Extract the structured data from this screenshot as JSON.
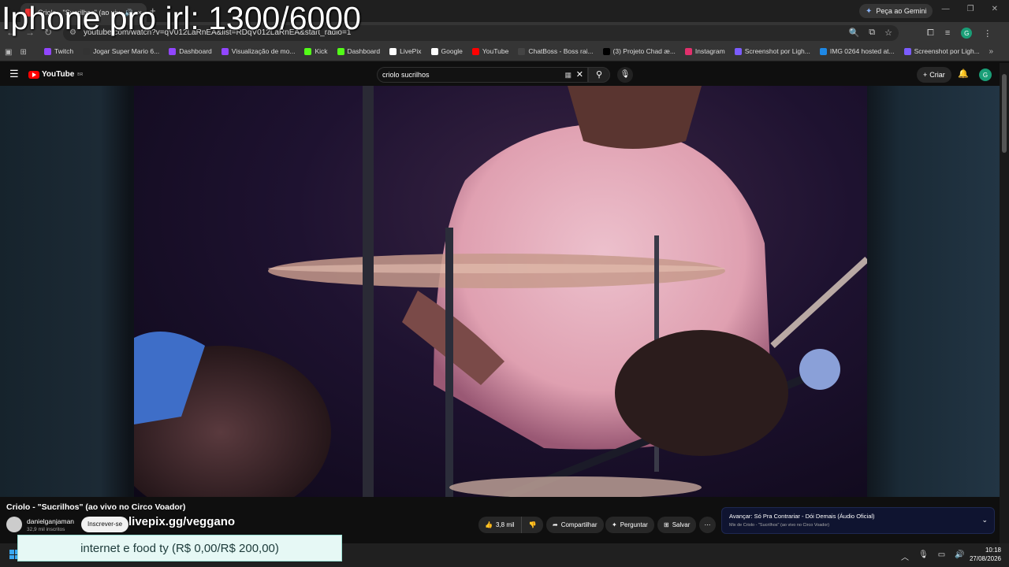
{
  "overlay": {
    "title": "Iphone pro irl: 1300/6000",
    "donation": "internet e food ty (R$ 0,00/R$ 200,00)",
    "livepix": "livepix.gg/veggano"
  },
  "browser": {
    "tab_title": "Criolo - \"Sucrilhos\" (ao vivo",
    "gemini_label": "Peça ao Gemini",
    "url": "youtube.com/watch?v=qV012LaRnEA&list=RDqV012LaRnEA&start_radio=1",
    "profile_initial": "G",
    "bookmarks": [
      {
        "label": "Twitch",
        "color": "#9146ff"
      },
      {
        "label": "Jogar Super Mario 6...",
        "color": "#333333"
      },
      {
        "label": "Dashboard",
        "color": "#9146ff"
      },
      {
        "label": "Visualização de mo...",
        "color": "#9146ff"
      },
      {
        "label": "Kick",
        "color": "#53fc18"
      },
      {
        "label": "Dashboard",
        "color": "#53fc18"
      },
      {
        "label": "LivePix",
        "color": "#ffffff"
      },
      {
        "label": "Google",
        "color": "#ffffff"
      },
      {
        "label": "YouTube",
        "color": "#ff0000"
      },
      {
        "label": "ChatBoss - Boss rai...",
        "color": "#444444"
      },
      {
        "label": "(3) Projeto Chad æ...",
        "color": "#000000"
      },
      {
        "label": "Instagram",
        "color": "#e1306c"
      },
      {
        "label": "Screenshot por Ligh...",
        "color": "#7b5cff"
      },
      {
        "label": "IMG 0264 hosted at...",
        "color": "#1e88e5"
      },
      {
        "label": "Screenshot por Ligh...",
        "color": "#7b5cff"
      }
    ]
  },
  "youtube": {
    "logo_text": "YouTube",
    "region": "BR",
    "search_query": "criolo sucrilhos",
    "create_label": "Criar",
    "avatar_initial": "G",
    "video_title": "Criolo - \"Sucrilhos\" (ao vivo no Circo Voador)",
    "channel_name": "danielganjaman",
    "channel_subs": "32,9 mil inscritos",
    "subscribe_label": "Inscrever-se",
    "like_count": "3,8 mil",
    "share_label": "Compartilhar",
    "ask_label": "Perguntar",
    "save_label": "Salvar",
    "next_prefix": "Avançar:",
    "next_title": "Só Pra Contrariar - Dói Demais (Áudio Oficial)",
    "next_sub": "Mix de Criolo - \"Sucrilhos\" (ao vivo no Circo Voador)"
  },
  "taskbar": {
    "time": "10:18",
    "date": "27/08/2026"
  },
  "colors": {
    "yt_red": "#ff0000",
    "donation_bg": "#e6f8f5",
    "next_card_bg": "#0f1430"
  }
}
